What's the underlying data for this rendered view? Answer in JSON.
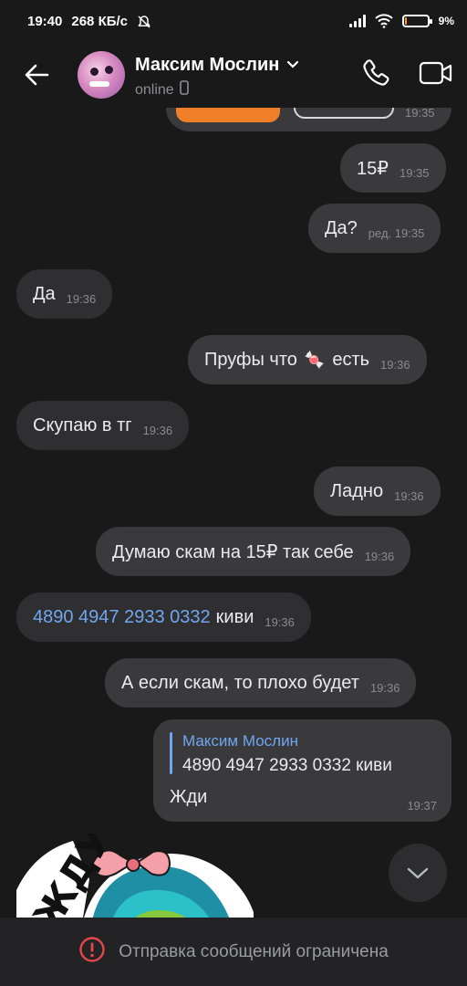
{
  "statusbar": {
    "time": "19:40",
    "speed": "268 КБ/с",
    "battery": "9%",
    "battery_level": 0.09
  },
  "header": {
    "contact_name": "Максим Мослин",
    "status": "online"
  },
  "partial_message": {
    "time": "19:35"
  },
  "messages": [
    {
      "text": "15₽",
      "time": "19:35",
      "direction": "out"
    },
    {
      "text": "Да?",
      "edited": "ред.",
      "time": "19:35",
      "direction": "out"
    },
    {
      "text": "Да",
      "time": "19:36",
      "direction": "in"
    },
    {
      "text": "Пруфы что",
      "emoji": "🍬",
      "text_after": "есть",
      "time": "19:36",
      "direction": "out"
    },
    {
      "text": "Скупаю в тг",
      "time": "19:36",
      "direction": "in"
    },
    {
      "text": "Ладно",
      "time": "19:36",
      "direction": "out"
    },
    {
      "text": "Думаю скам на 15₽ так себе",
      "time": "19:36",
      "direction": "out"
    },
    {
      "link": "4890 4947 2933 0332",
      "text": "киви",
      "time": "19:36",
      "direction": "in"
    },
    {
      "text": "А если скам, то плохо будет",
      "time": "19:36",
      "direction": "out"
    }
  ],
  "reply_message": {
    "quoted_name": "Максим Мослин",
    "quoted_text": "4890 4947 2933 0332 киви",
    "text": "Жди",
    "time": "19:37"
  },
  "sticker": {
    "caption": "ЖДУ"
  },
  "footer": {
    "notice": "Отправка сообщений ограничена"
  },
  "colors": {
    "background": "#19191a",
    "bubble_out": "#3a3a3d",
    "bubble_in": "#2f2f31",
    "link": "#6fa6ef",
    "warning": "#e2474b"
  }
}
